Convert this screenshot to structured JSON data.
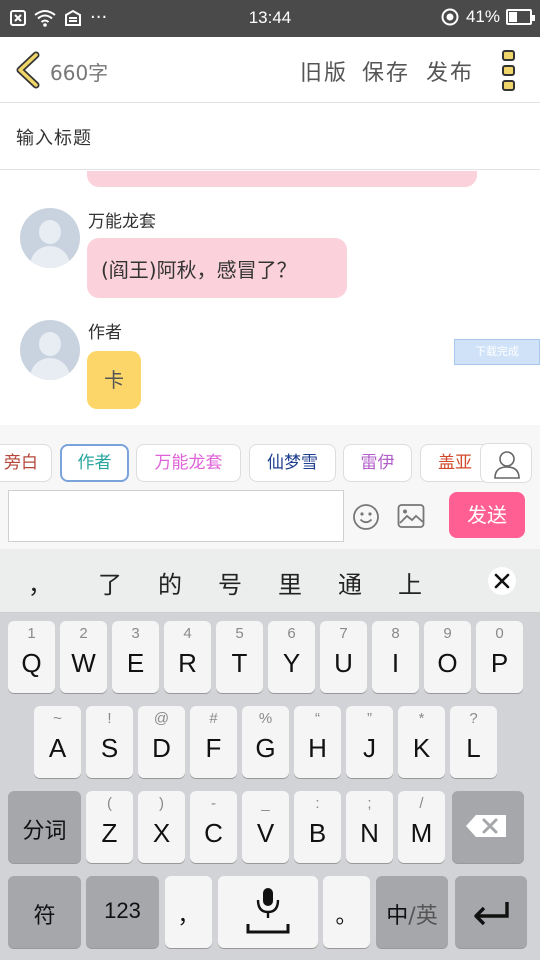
{
  "status_bar": {
    "time": "13:44",
    "battery": "41%",
    "battery_level": 0.41,
    "more": "···"
  },
  "header": {
    "word_count": "660字",
    "old_version": "旧版",
    "save": "保存",
    "publish": "发布"
  },
  "title_field": {
    "placeholder": "输入标题"
  },
  "messages": [
    {
      "name": "万能龙套",
      "text": "(阎王)阿秋，感冒了？"
    },
    {
      "name": "作者",
      "text": "卡"
    }
  ],
  "toast": "下载完成",
  "characters": [
    {
      "label": "旁白",
      "color": "#b5463a"
    },
    {
      "label": "作者",
      "color": "#2aa6a0"
    },
    {
      "label": "万能龙套",
      "color": "#e062d8"
    },
    {
      "label": "仙梦雪",
      "color": "#1f3f8f"
    },
    {
      "label": "雷伊",
      "color": "#b25fc9"
    },
    {
      "label": "盖亚",
      "color": "#d14a2a"
    }
  ],
  "composer": {
    "send": "发送"
  },
  "keyboard": {
    "candidates": [
      "，",
      "了",
      "的",
      "号",
      "里",
      "通",
      "上"
    ],
    "row1": [
      [
        "1",
        "Q"
      ],
      [
        "2",
        "W"
      ],
      [
        "3",
        "E"
      ],
      [
        "4",
        "R"
      ],
      [
        "5",
        "T"
      ],
      [
        "6",
        "Y"
      ],
      [
        "7",
        "U"
      ],
      [
        "8",
        "I"
      ],
      [
        "9",
        "O"
      ],
      [
        "0",
        "P"
      ]
    ],
    "row2": [
      [
        "~",
        "A"
      ],
      [
        "!",
        "S"
      ],
      [
        "@",
        "D"
      ],
      [
        "#",
        "F"
      ],
      [
        "%",
        "G"
      ],
      [
        "“",
        "H"
      ],
      [
        "”",
        "J"
      ],
      [
        "*",
        "K"
      ],
      [
        "?",
        "L"
      ]
    ],
    "row3": [
      [
        "(",
        "Z"
      ],
      [
        ")",
        "X"
      ],
      [
        "-",
        "C"
      ],
      [
        "_",
        "V"
      ],
      [
        ":",
        "B"
      ],
      [
        ";",
        "N"
      ],
      [
        "/",
        "M"
      ]
    ],
    "segment": "分词",
    "symbols": "符",
    "numbers": "123",
    "comma": "，",
    "period": "。",
    "lang_zh": "中",
    "lang_en": "/英"
  }
}
